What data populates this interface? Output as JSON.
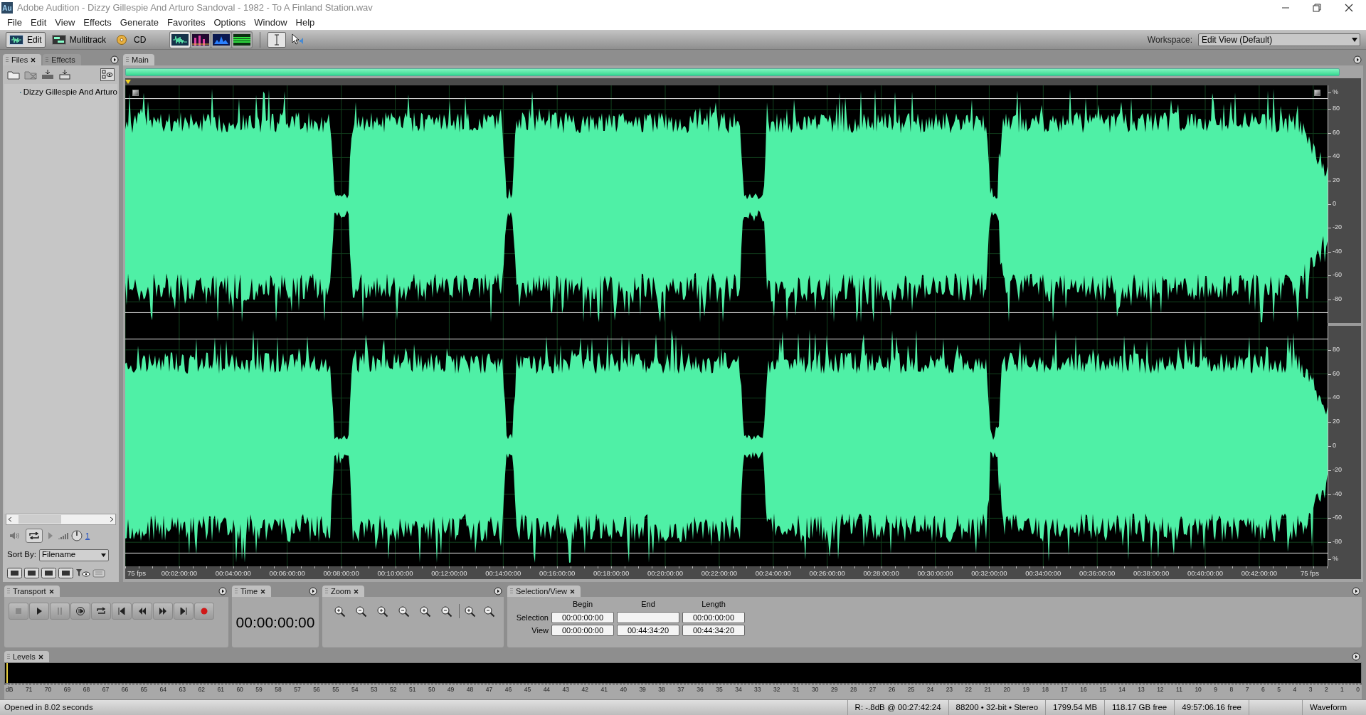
{
  "window": {
    "app_icon": "Au",
    "title": "Adobe Audition - Dizzy Gillespie And Arturo Sandoval - 1982 - To A Finland Station.wav"
  },
  "menu": [
    "File",
    "Edit",
    "View",
    "Effects",
    "Generate",
    "Favorites",
    "Options",
    "Window",
    "Help"
  ],
  "toolbar": {
    "modes": [
      {
        "label": "Edit",
        "kind": "edit",
        "selected": true
      },
      {
        "label": "Multitrack",
        "kind": "multitrack",
        "selected": false
      },
      {
        "label": "CD",
        "kind": "cd",
        "selected": false
      }
    ],
    "views": [
      {
        "kind": "waveform",
        "selected": true
      },
      {
        "kind": "spectral",
        "selected": false
      },
      {
        "kind": "pan",
        "selected": false
      },
      {
        "kind": "phase",
        "selected": false
      }
    ],
    "tools": [
      {
        "kind": "time-selection",
        "selected": true
      },
      {
        "kind": "scrub",
        "selected": false
      }
    ],
    "workspace_label": "Workspace:",
    "workspace": "Edit View (Default)"
  },
  "files_panel": {
    "tabs": [
      {
        "label": "Files",
        "selected": true
      },
      {
        "label": "Effects",
        "selected": false
      }
    ],
    "files": [
      "Dizzy Gillespie And Arturo"
    ],
    "volume": "1",
    "sort_label": "Sort By:",
    "sort_value": "Filename"
  },
  "editor": {
    "tab": "Main",
    "channels": [
      {
        "axis": [
          "%",
          "80",
          "60",
          "40",
          "20",
          "0",
          "-20",
          "-40",
          "-60",
          "-80"
        ]
      },
      {
        "axis": [
          "80",
          "60",
          "40",
          "20",
          "0",
          "-20",
          "-40",
          "-60",
          "-80",
          "%"
        ]
      }
    ],
    "time_ruler": [
      "75 fps",
      "00:02:00:00",
      "00:04:00:00",
      "00:06:00:00",
      "00:08:00:00",
      "00:10:00:00",
      "00:12:00:00",
      "00:14:00:00",
      "00:16:00:00",
      "00:18:00:00",
      "00:20:00:00",
      "00:22:00:00",
      "00:24:00:00",
      "00:26:00:00",
      "00:28:00:00",
      "00:30:00:00",
      "00:32:00:00",
      "00:34:00:00",
      "00:36:00:00",
      "00:38:00:00",
      "00:40:00:00",
      "00:42:00:00",
      "75 fps"
    ]
  },
  "panels": [
    {
      "title": "Transport",
      "kind": "transport"
    },
    {
      "title": "Time",
      "kind": "time",
      "value": "00:00:00:00"
    },
    {
      "title": "Zoom",
      "kind": "zoom"
    },
    {
      "title": "Selection/View",
      "kind": "selection",
      "columns": [
        "Begin",
        "End",
        "Length"
      ],
      "rows": [
        {
          "label": "Selection",
          "begin": "00:00:00:00",
          "length": "00:00:00:00"
        },
        {
          "label": "View",
          "begin": "00:00:00:00",
          "end": "00:44:34:20",
          "length": "00:44:34:20"
        }
      ]
    }
  ],
  "levels": {
    "title": "Levels",
    "scale": [
      "dB",
      "71",
      "70",
      "69",
      "68",
      "67",
      "66",
      "65",
      "64",
      "63",
      "62",
      "61",
      "60",
      "59",
      "58",
      "57",
      "56",
      "55",
      "54",
      "53",
      "52",
      "51",
      "50",
      "49",
      "48",
      "47",
      "46",
      "45",
      "44",
      "43",
      "42",
      "41",
      "40",
      "39",
      "38",
      "37",
      "36",
      "35",
      "34",
      "33",
      "32",
      "31",
      "30",
      "29",
      "28",
      "27",
      "26",
      "25",
      "24",
      "23",
      "22",
      "21",
      "20",
      "19",
      "18",
      "17",
      "16",
      "15",
      "14",
      "13",
      "12",
      "11",
      "10",
      "9",
      "8",
      "7",
      "6",
      "5",
      "4",
      "3",
      "2",
      "1",
      "0"
    ]
  },
  "status_bar": {
    "message": "Opened in 8.02 seconds",
    "cells": [
      "R: -.8dB @ 00:27:42:24",
      "88200 • 32-bit • Stereo",
      "1799.54 MB",
      "118.17 GB free",
      "49:57:06.16 free"
    ],
    "view_mode": "Waveform"
  }
}
